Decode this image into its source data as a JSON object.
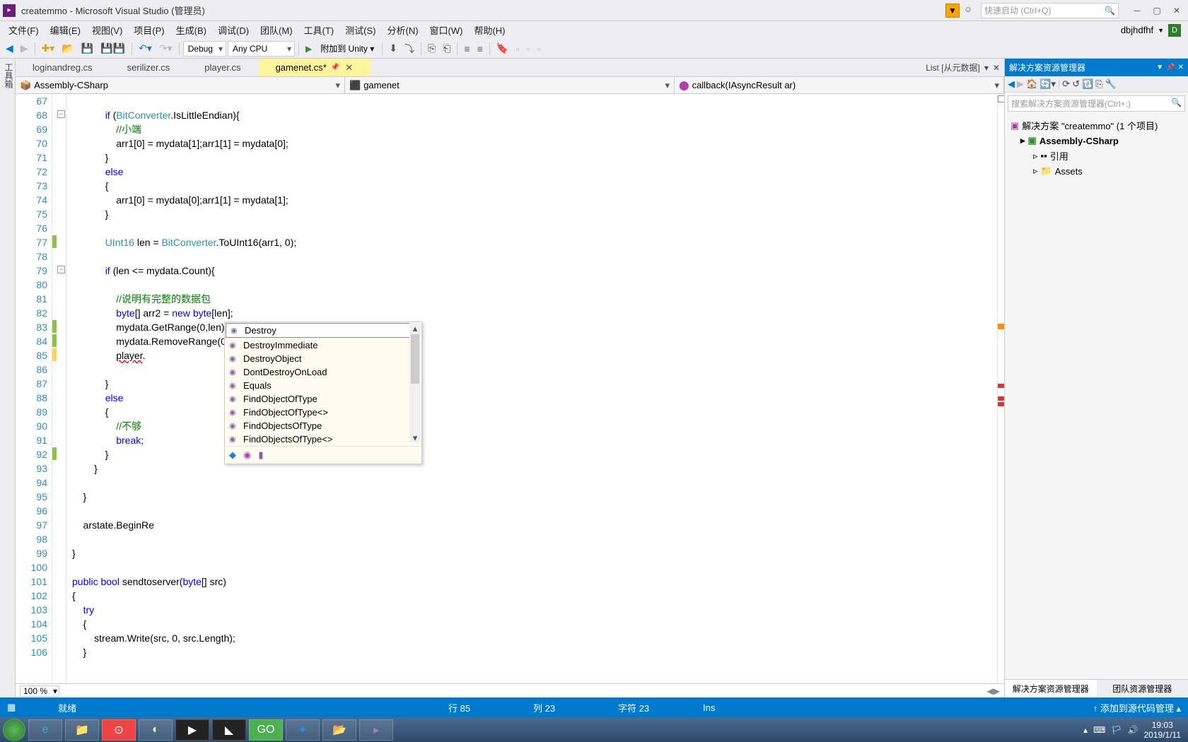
{
  "window": {
    "title": "createmmo - Microsoft Visual Studio (管理员)",
    "quicklaunch_placeholder": "快速启动 (Ctrl+Q)"
  },
  "menu": {
    "items": [
      "文件(F)",
      "编辑(E)",
      "视图(V)",
      "项目(P)",
      "生成(B)",
      "调试(D)",
      "团队(M)",
      "工具(T)",
      "测试(S)",
      "分析(N)",
      "窗口(W)",
      "帮助(H)"
    ],
    "user": "dbjhdfhf"
  },
  "toolbar": {
    "config": "Debug",
    "platform": "Any CPU",
    "attach": "附加到 Unity"
  },
  "sidetab": "工具箱",
  "tabs": {
    "items": [
      "loginandreg.cs",
      "serilizer.cs",
      "player.cs",
      "gamenet.cs*"
    ],
    "active_index": 3,
    "right_label": "List [从元数据]"
  },
  "combos": {
    "left": "Assembly-CSharp",
    "mid": "gamenet",
    "right": "callback(IAsyncResult ar)"
  },
  "code": {
    "first_line": 67,
    "lines": [
      "",
      "            if (BitConverter.IsLittleEndian){",
      "                //小端",
      "                arr1[0] = mydata[1];arr1[1] = mydata[0];",
      "            }",
      "            else",
      "            {",
      "                arr1[0] = mydata[0];arr1[1] = mydata[1];",
      "            }",
      "",
      "            UInt16 len = BitConverter.ToUInt16(arr1, 0);",
      "",
      "            if (len <= mydata.Count){",
      "",
      "                //说明有完整的数据包",
      "                byte[] arr2 = new byte[len];",
      "                mydata.GetRange(0,len).CopyTo(arr2,0);",
      "                mydata.RemoveRange(0, len);",
      "                player.",
      "",
      "            }",
      "            else",
      "            {",
      "                //不够",
      "                break;",
      "            }",
      "        }",
      "",
      "    }",
      "",
      "    arstate.BeginRe",
      "",
      "}",
      "",
      "public bool sendtoserver(byte[] src)",
      "{",
      "    try",
      "    {",
      "        stream.Write(src, 0, src.Length);",
      "    }"
    ]
  },
  "intellisense": {
    "items": [
      "Destroy",
      "DestroyImmediate",
      "DestroyObject",
      "DontDestroyOnLoad",
      "Equals",
      "FindObjectOfType",
      "FindObjectOfType<>",
      "FindObjectsOfType",
      "FindObjectsOfType<>"
    ],
    "selected_index": 0
  },
  "zoom": "100 %",
  "solution": {
    "title": "解决方案资源管理器",
    "search_placeholder": "搜索解决方案资源管理器(Ctrl+;)",
    "root": "解决方案 \"createmmo\" (1 个项目)",
    "project": "Assembly-CSharp",
    "nodes": [
      "引用",
      "Assets"
    ],
    "bottom_tabs": [
      "解决方案资源管理器",
      "团队资源管理器"
    ]
  },
  "statusbar": {
    "ready": "就绪",
    "line": "行 85",
    "col": "列 23",
    "char": "字符 23",
    "ins": "Ins",
    "source": "↑ 添加到源代码管理 ▴"
  },
  "taskbar": {
    "time": "19:03",
    "date": "2019/1/11"
  }
}
